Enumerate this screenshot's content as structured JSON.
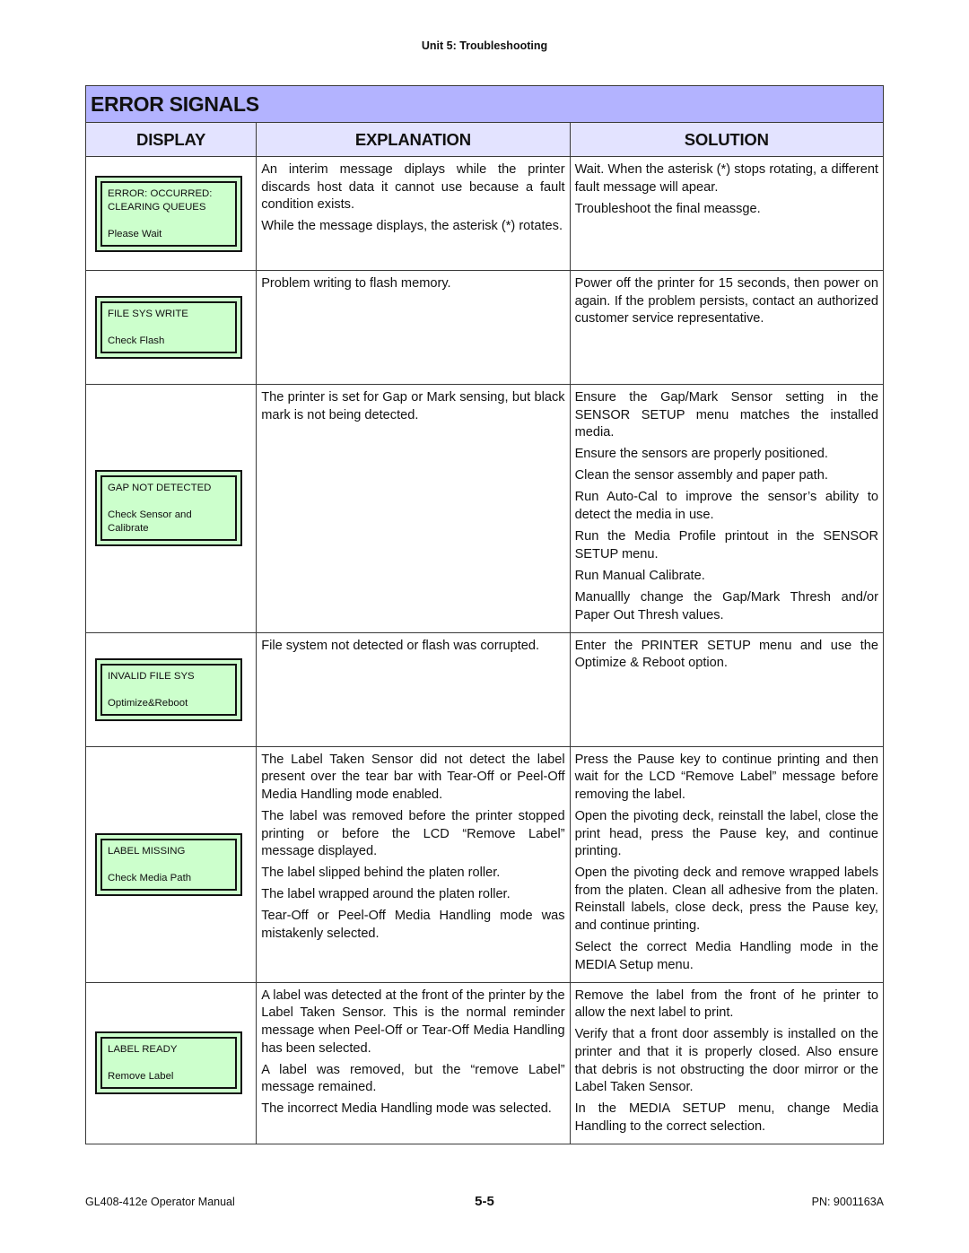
{
  "running_head": "Unit 5:  Troubleshooting",
  "table": {
    "title": "ERROR SIGNALS",
    "columns": [
      "DISPLAY",
      "EXPLANATION",
      "SOLUTION"
    ],
    "colors": {
      "title_bg": "#b3b3ff",
      "header_bg": "#e3e3ff",
      "lcd_bg": "#ccffcc"
    },
    "rows": [
      {
        "display": {
          "line1": "ERROR: OCCURRED:",
          "line2": "CLEARING QUEUES",
          "line3": "Please Wait"
        },
        "explanation": [
          "An interim message diplays while the printer discards host data it cannot use because a fault condition exists.",
          "While the message displays, the asterisk (*) rotates."
        ],
        "solution": [
          "Wait. When the asterisk (*) stops rotating, a different fault message will apear.",
          "Troubleshoot the final meassge."
        ]
      },
      {
        "display": {
          "line1": "FILE SYS WRITE",
          "line2": "",
          "line3": "Check Flash"
        },
        "explanation": [
          "Problem writing to flash memory."
        ],
        "solution": [
          "Power off the printer for 15 seconds, then power on again. If the problem persists, contact an authorized customer service representative."
        ]
      },
      {
        "display": {
          "line1": "GAP NOT DETECTED",
          "line2": "",
          "line3": "Check Sensor and Calibrate"
        },
        "explanation": [
          "The printer is set for Gap or Mark sensing, but black mark is not being detected."
        ],
        "solution": [
          "Ensure the Gap/Mark Sensor setting in the SENSOR SETUP menu matches the installed media.",
          "Ensure the sensors are properly positioned.",
          "Clean the sensor assembly and paper path.",
          "Run Auto-Cal to improve the sensor’s ability to detect the media in use.",
          "Run the Media Profile printout in the SENSOR SETUP menu.",
          "Run Manual Calibrate.",
          "Manuallly change the Gap/Mark Thresh and/or Paper Out Thresh values."
        ]
      },
      {
        "display": {
          "line1": "INVALID FILE SYS",
          "line2": "",
          "line3": "Optimize&Reboot"
        },
        "explanation": [
          "File system not detected or flash was corrupted."
        ],
        "solution": [
          "Enter the PRINTER SETUP menu and use the Optimize & Reboot option."
        ]
      },
      {
        "display": {
          "line1": "LABEL MISSING",
          "line2": "",
          "line3": "Check Media Path"
        },
        "explanation": [
          "The Label Taken Sensor did not detect the label present over the tear bar with Tear-Off or Peel-Off Media Handling mode enabled.",
          "The label was removed before the printer stopped printing or before the LCD “Remove Label” message displayed.",
          "The label slipped behind the platen roller.",
          "The label wrapped around the platen roller.",
          "Tear-Off or Peel-Off Media Handling mode was mistakenly selected."
        ],
        "solution": [
          "Press the Pause key to continue printing and then wait for the LCD “Remove Label” message before removing the label.",
          "Open the pivoting deck, reinstall the label, close the print head, press the Pause key, and continue printing.",
          "Open the pivoting deck and remove wrapped labels from the platen. Clean all adhesive from the platen. Reinstall labels, close deck, press the Pause key, and continue printing.",
          "Select the correct Media Handling mode in the MEDIA Setup menu."
        ]
      },
      {
        "display": {
          "line1": "LABEL READY",
          "line2": "",
          "line3": "Remove Label"
        },
        "explanation": [
          "A label was detected at the front of the printer by the Label Taken Sensor. This is the normal reminder message when Peel-Off or Tear-Off Media Handling has been selected.",
          "A label was removed, but the “remove Label” message remained.",
          "The incorrect Media Handling mode was selected."
        ],
        "solution": [
          "Remove the label from the front of he printer to allow the next label to print.",
          "Verify that a front door assembly is installed on the printer and that it is properly closed. Also ensure that debris is not obstructing the door mirror or the Label Taken Sensor.",
          "In the MEDIA SETUP menu, change Media Handling to the correct selection."
        ]
      }
    ]
  },
  "footer": {
    "left": "GL408-412e Operator Manual",
    "center": "5-5",
    "right": "PN: 9001163A"
  }
}
